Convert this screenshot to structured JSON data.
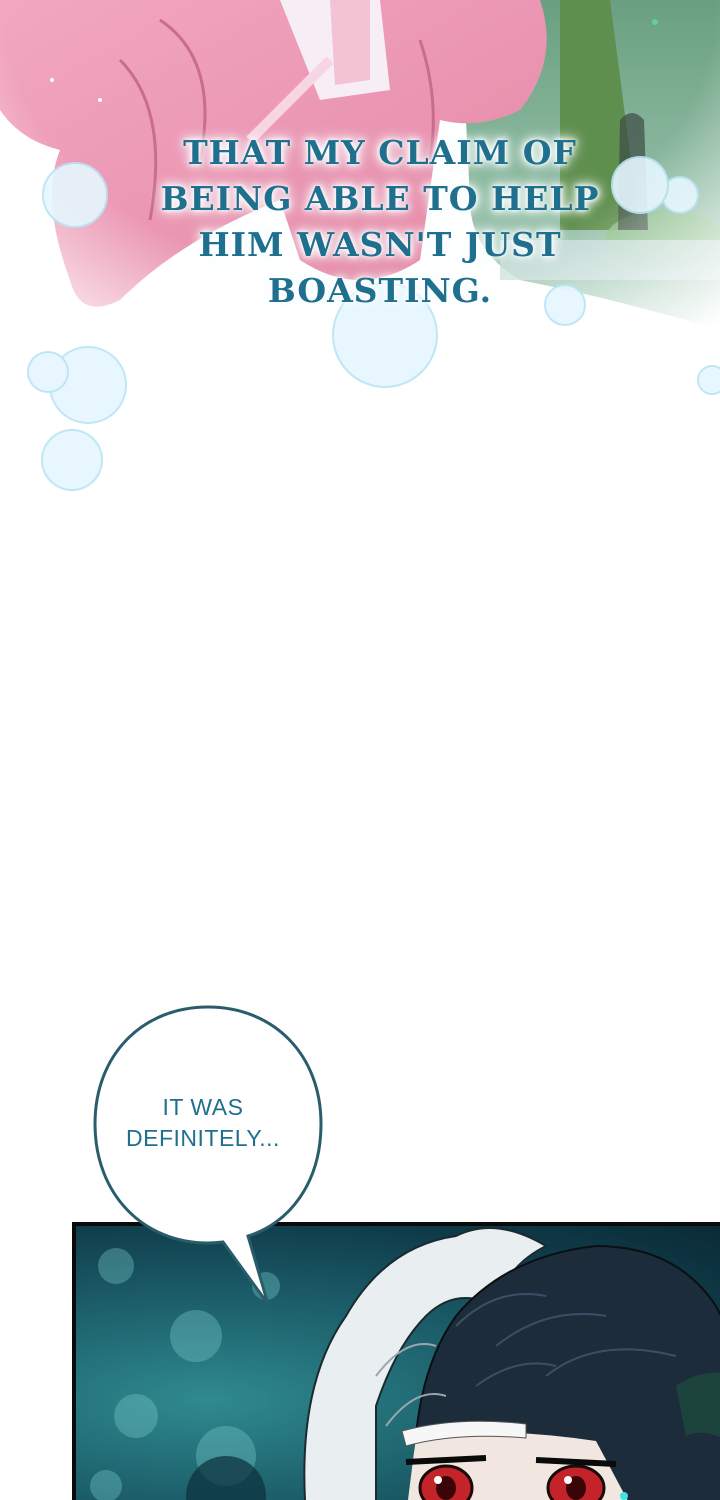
{
  "narration": {
    "text": "THAT MY CLAIM OF BEING ABLE TO HELP HIM WASN'T JUST BOASTING."
  },
  "speech_bubble": {
    "text": "IT WAS DEFINITELY..."
  },
  "colors": {
    "text_teal": "#1f6f8f",
    "panel_border": "#0a0a0a",
    "eye_red": "#c4232a"
  }
}
